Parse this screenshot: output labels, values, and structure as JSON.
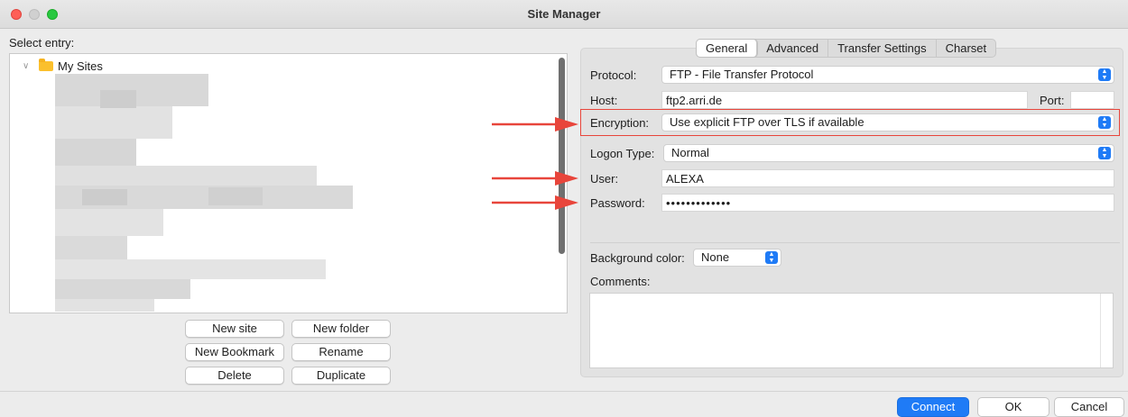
{
  "window": {
    "title": "Site Manager"
  },
  "tree": {
    "label": "Select entry:",
    "root": "My Sites"
  },
  "tree_buttons": {
    "new_site": "New site",
    "new_folder": "New folder",
    "new_bookmark": "New Bookmark",
    "rename": "Rename",
    "delete": "Delete",
    "duplicate": "Duplicate"
  },
  "tabs": [
    "General",
    "Advanced",
    "Transfer Settings",
    "Charset"
  ],
  "form": {
    "protocol_label": "Protocol:",
    "protocol_value": "FTP - File Transfer Protocol",
    "host_label": "Host:",
    "host_value": "ftp2.arri.de",
    "port_label": "Port:",
    "port_value": "",
    "encryption_label": "Encryption:",
    "encryption_value": "Use explicit FTP over TLS if available",
    "logon_label": "Logon Type:",
    "logon_value": "Normal",
    "user_label": "User:",
    "user_value": "ALEXA",
    "password_label": "Password:",
    "password_value": "•••••••••••••",
    "bg_color_label": "Background color:",
    "bg_color_value": "None",
    "comments_label": "Comments:"
  },
  "dialog_buttons": {
    "connect": "Connect",
    "ok": "OK",
    "cancel": "Cancel"
  },
  "colors": {
    "accent": "#1f7bf6",
    "annotation_red": "#e8453b",
    "folder": "#fbc02d"
  },
  "icons": [
    "chevron-down-icon",
    "folder-icon",
    "select-arrows-icon",
    "annotation-arrow-icon"
  ]
}
